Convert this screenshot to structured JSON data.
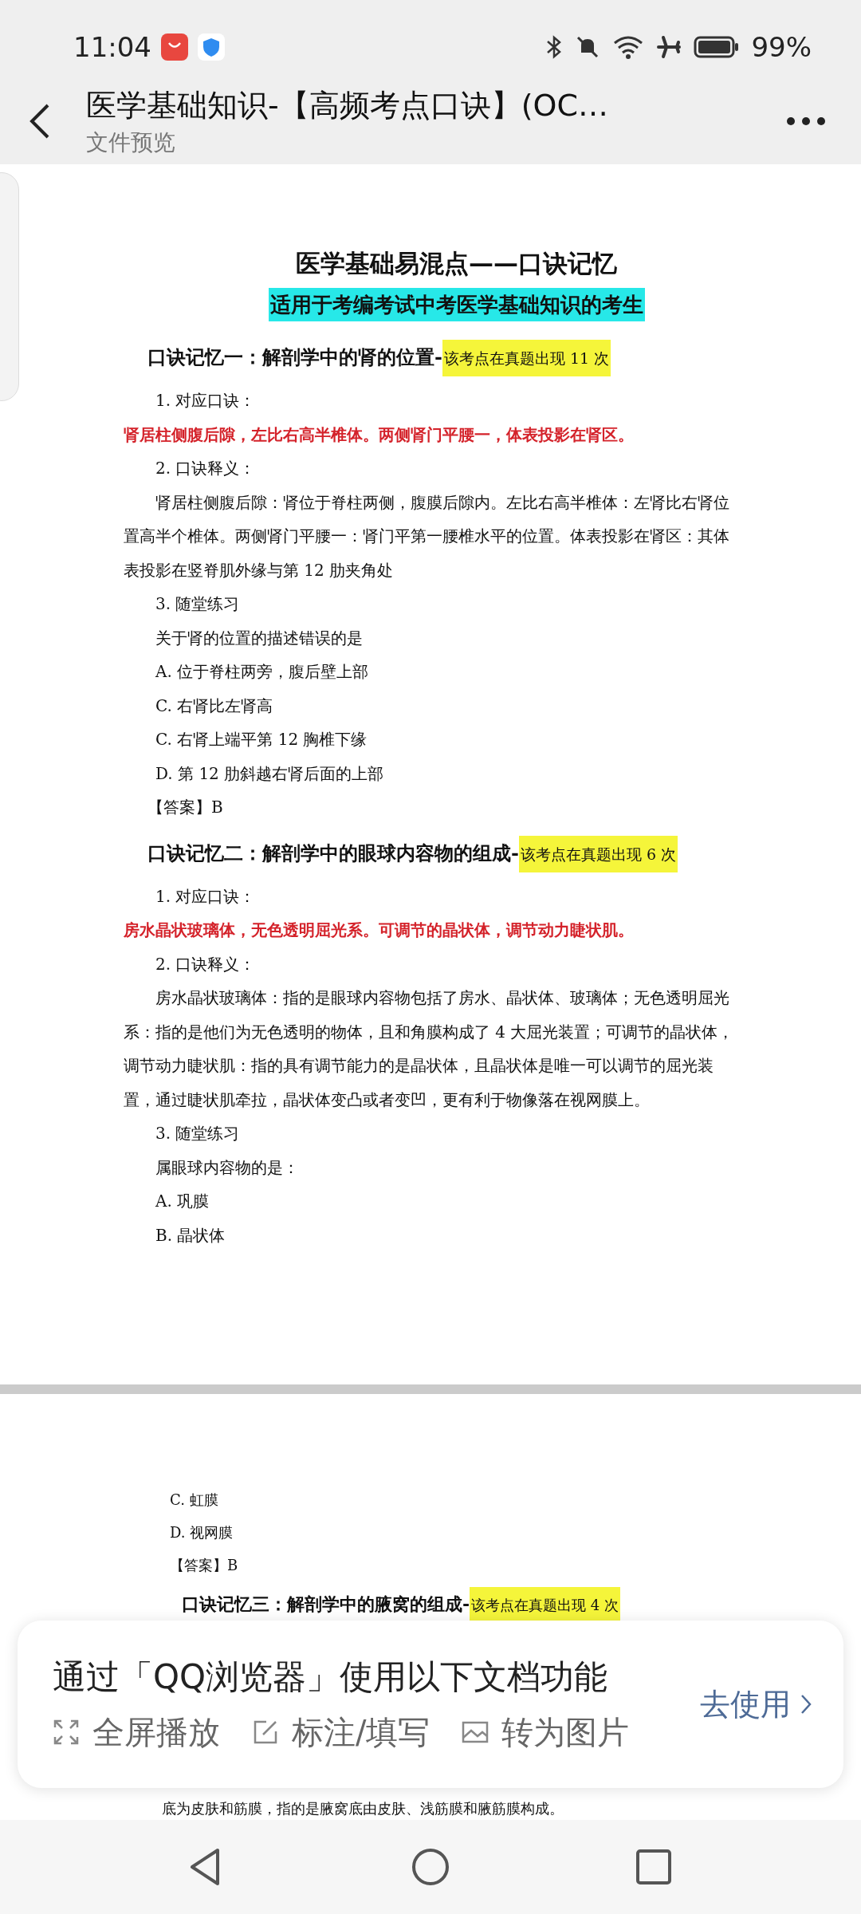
{
  "status_bar": {
    "time": "11:04",
    "battery": "99%"
  },
  "header": {
    "title": "医学基础知识-【高频考点口诀】(OC…",
    "subtitle": "文件预览"
  },
  "document": {
    "pages": [
      {
        "blocks": [
          {
            "kind": "title",
            "text": "医学基础易混点——口诀记忆"
          },
          {
            "kind": "subtitle",
            "text": "适用于考编考试中考医学基础知识的考生"
          },
          {
            "kind": "heading",
            "text": "口诀记忆一：解剖学中的肾的位置-",
            "note": "该考点在真题出现 11 次"
          },
          {
            "kind": "label",
            "text": "1. 对应口诀："
          },
          {
            "kind": "mnemonic",
            "text": "肾居柱侧腹后隙，左比右高半椎体。两侧肾门平腰一，体表投影在肾区。"
          },
          {
            "kind": "label",
            "text": "2. 口诀释义："
          },
          {
            "kind": "paragraph",
            "text": "肾居柱侧腹后隙：肾位于脊柱两侧，腹膜后隙内。左比右高半椎体：左肾比右肾位置高半个椎体。两侧肾门平腰一：肾门平第一腰椎水平的位置。体表投影在肾区：其体表投影在竖脊肌外缘与第 12 肋夹角处"
          },
          {
            "kind": "label",
            "text": "3. 随堂练习"
          },
          {
            "kind": "label",
            "text": "关于肾的位置的描述错误的是"
          },
          {
            "kind": "label",
            "text": "A. 位于脊柱两旁，腹后壁上部"
          },
          {
            "kind": "label",
            "text": "C. 右肾比左肾高"
          },
          {
            "kind": "label",
            "text": "C. 右肾上端平第 12 胸椎下缘"
          },
          {
            "kind": "label",
            "text": "D. 第 12 肋斜越右肾后面的上部"
          },
          {
            "kind": "answer",
            "text": "【答案】B"
          },
          {
            "kind": "heading",
            "text": "口诀记忆二：解剖学中的眼球内容物的组成-",
            "note": "该考点在真题出现 6 次"
          },
          {
            "kind": "label",
            "text": "1. 对应口诀："
          },
          {
            "kind": "mnemonic",
            "text": "房水晶状玻璃体，无色透明屈光系。可调节的晶状体，调节动力睫状肌。"
          },
          {
            "kind": "label",
            "text": "2. 口诀释义："
          },
          {
            "kind": "paragraph",
            "text": "房水晶状玻璃体：指的是眼球内容物包括了房水、晶状体、玻璃体；无色透明屈光系：指的是他们为无色透明的物体，且和角膜构成了 4 大屈光装置；可调节的晶状体，调节动力睫状肌：指的具有调节能力的是晶状体，且晶状体是唯一可以调节的屈光装置，通过睫状肌牵拉，晶状体变凸或者变凹，更有利于物像落在视网膜上。"
          },
          {
            "kind": "label",
            "text": "3. 随堂练习"
          },
          {
            "kind": "label",
            "text": "属眼球内容物的是："
          },
          {
            "kind": "label",
            "text": "A. 巩膜"
          },
          {
            "kind": "label",
            "text": "B. 晶状体"
          }
        ]
      },
      {
        "blocks": [
          {
            "kind": "option",
            "text": "C. 虹膜"
          },
          {
            "kind": "option",
            "text": "D. 视网膜"
          },
          {
            "kind": "answer",
            "text": "【答案】B"
          },
          {
            "kind": "heading",
            "text": "口诀记忆三：解剖学中的腋窝的组成-",
            "note": "该考点在真题出现 4 次"
          },
          {
            "kind": "tail",
            "text": "底为皮肤和筋膜，指的是腋窝底由皮肤、浅筋膜和腋筋膜构成。"
          }
        ]
      }
    ]
  },
  "banner": {
    "message": "通过「QQ浏览器」使用以下文档功能",
    "features": [
      {
        "kind": "fullscreen",
        "label": "全屏播放"
      },
      {
        "kind": "annotate",
        "label": "标注/填写"
      },
      {
        "kind": "image",
        "label": "转为图片"
      }
    ],
    "action": "去使用"
  }
}
